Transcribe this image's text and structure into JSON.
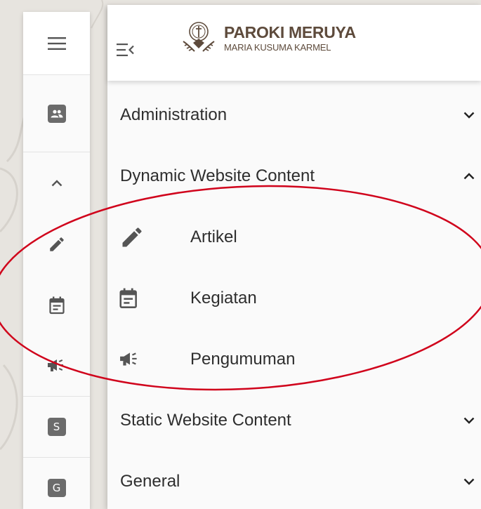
{
  "brand": {
    "title": "PAROKI MERUYA",
    "subtitle": "MARIA KUSUMA KARMEL"
  },
  "rail": {
    "items": [
      {
        "icon": "people-icon"
      },
      {
        "icon": "chevron-up-icon"
      },
      {
        "icon": "pencil-icon"
      },
      {
        "icon": "calendar-note-icon"
      },
      {
        "icon": "megaphone-icon"
      },
      {
        "icon": "letter-box-icon",
        "letter": "S"
      },
      {
        "icon": "letter-box-icon",
        "letter": "G"
      }
    ]
  },
  "menu": {
    "items": [
      {
        "label": "Administration",
        "expanded": false
      },
      {
        "label": "Dynamic Website Content",
        "expanded": true
      },
      {
        "label": "Static Website Content",
        "expanded": false
      },
      {
        "label": "General",
        "expanded": false
      }
    ],
    "dynamic_children": [
      {
        "label": "Artikel",
        "icon": "pencil-icon"
      },
      {
        "label": "Kegiatan",
        "icon": "calendar-note-icon"
      },
      {
        "label": "Pengumuman",
        "icon": "megaphone-icon"
      }
    ]
  },
  "colors": {
    "icon": "#555555",
    "text": "#2e2e2e",
    "brand": "#5e4b3c",
    "highlight_oval": "#d0021b",
    "background": "#e7e4df"
  }
}
